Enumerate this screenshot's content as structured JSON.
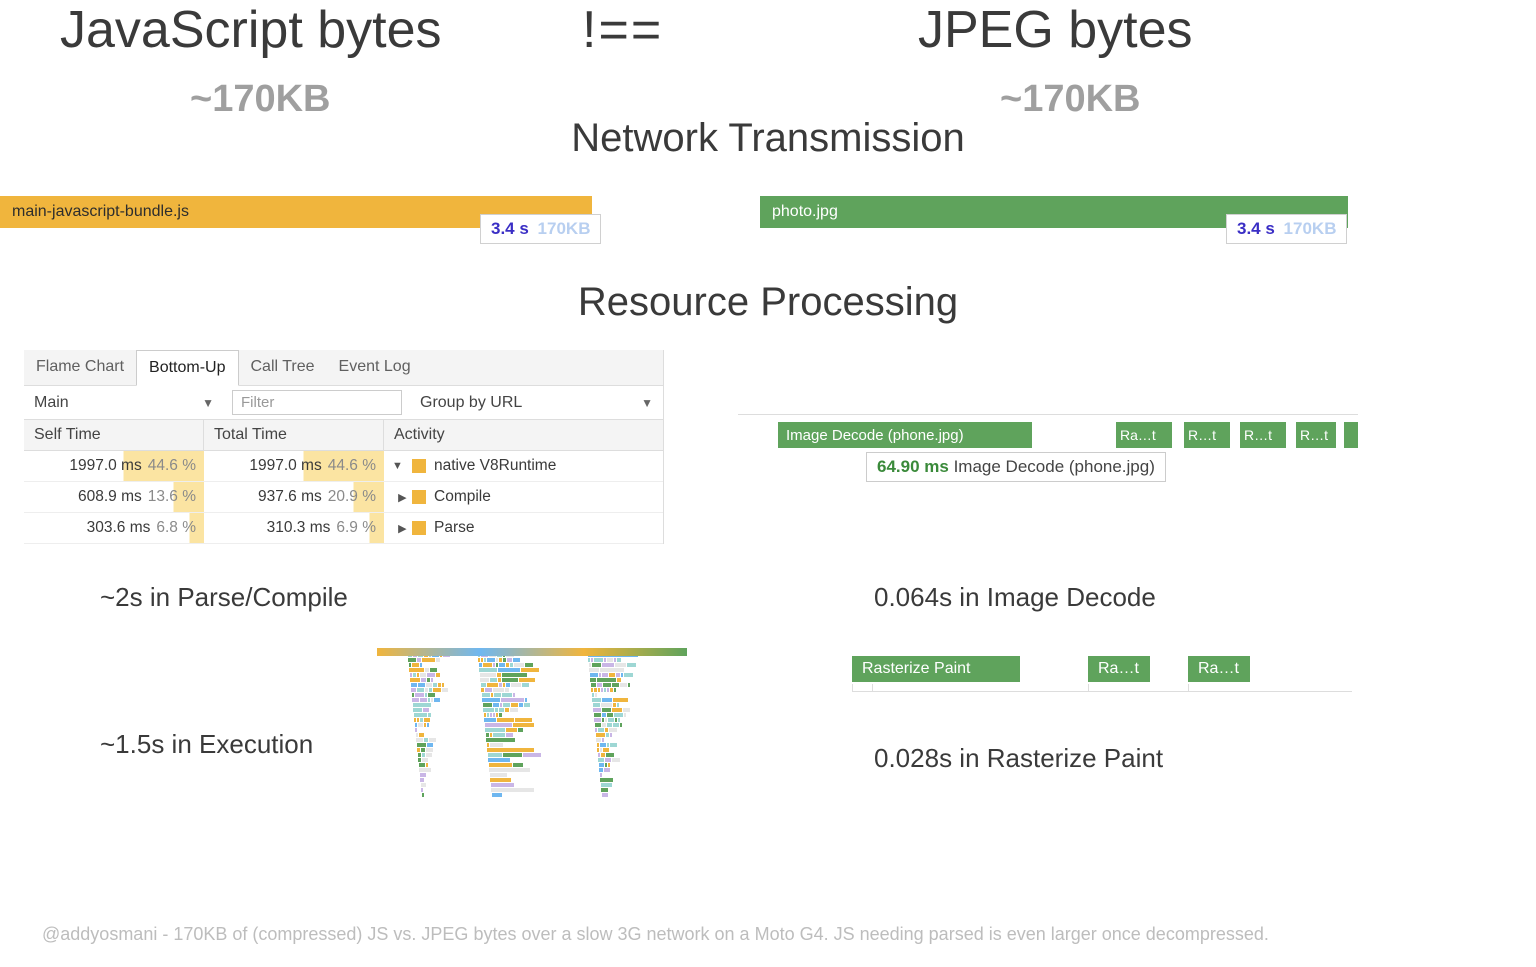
{
  "headings": {
    "js": "JavaScript bytes",
    "neq": "!==",
    "jpeg": "JPEG bytes",
    "js_kb": "~170KB",
    "jpeg_kb": "~170KB",
    "network": "Network Transmission",
    "resource": "Resource Processing"
  },
  "network": {
    "js_bar_label": "main-javascript-bundle.js",
    "jpeg_bar_label": "photo.jpg",
    "js_time": "3.4 s",
    "js_size": "170KB",
    "jpeg_time": "3.4 s",
    "jpeg_size": "170KB"
  },
  "devtools": {
    "tabs": [
      "Flame Chart",
      "Bottom-Up",
      "Call Tree",
      "Event Log"
    ],
    "active_tab": "Bottom-Up",
    "thread_select": "Main",
    "filter_placeholder": "Filter",
    "group_select": "Group by URL",
    "cols": [
      "Self Time",
      "Total Time",
      "Activity"
    ],
    "rows": [
      {
        "self_ms": "1997.0 ms",
        "self_pct": "44.6 %",
        "total_ms": "1997.0 ms",
        "total_pct": "44.6 %",
        "expand": "▼",
        "label": "native V8Runtime",
        "pct_css": "44.6%"
      },
      {
        "self_ms": "608.9 ms",
        "self_pct": "13.6 %",
        "total_ms": "937.6 ms",
        "total_pct": "20.9 %",
        "expand": "▶",
        "label": "Compile",
        "pct_css": "17%"
      },
      {
        "self_ms": "303.6 ms",
        "self_pct": "6.8 %",
        "total_ms": "310.3 ms",
        "total_pct": "6.9 %",
        "expand": "▶",
        "label": "Parse",
        "pct_css": "8%"
      }
    ]
  },
  "summaries": {
    "parse_compile": "~2s in Parse/Compile",
    "execution": "~1.5s in Execution",
    "image_decode": "0.064s in Image Decode",
    "raster": "0.028s in Rasterize Paint"
  },
  "decode_trace": {
    "big": "Image Decode (phone.jpg)",
    "small": "Ra…t",
    "small2": "R…t",
    "tip_ms": "64.90 ms",
    "tip_label": "Image Decode (phone.jpg)"
  },
  "raster_trace": {
    "big": "Rasterize Paint",
    "small": "Ra…t"
  },
  "footer": "@addyosmani - 170KB of (compressed) JS vs. JPEG bytes over a slow 3G network on a Moto G4. JS needing parsed is even larger once decompressed."
}
